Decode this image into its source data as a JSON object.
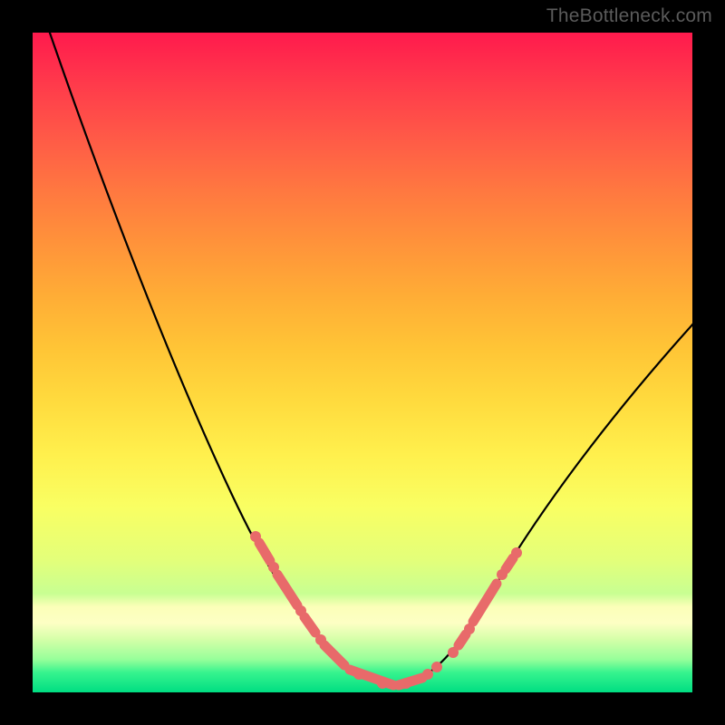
{
  "watermark": "TheBottleneck.com",
  "colors": {
    "background": "#000000",
    "curve": "#000000",
    "marker": "#e86a6a",
    "gradient_top": "#ff1a4d",
    "gradient_bottom": "#00de82"
  },
  "chart_data": {
    "type": "line",
    "title": "",
    "xlabel": "",
    "ylabel": "",
    "xlim": [
      0,
      1
    ],
    "ylim": [
      0,
      1
    ],
    "series": [
      {
        "name": "curve",
        "x": [
          0.02,
          0.06,
          0.1,
          0.14,
          0.18,
          0.22,
          0.26,
          0.3,
          0.34,
          0.38,
          0.42,
          0.46,
          0.5,
          0.54,
          0.58,
          0.62,
          0.66,
          0.7,
          0.74,
          0.78,
          0.82,
          0.86,
          0.9,
          0.94,
          0.98,
          1.0
        ],
        "y": [
          1.03,
          0.94,
          0.82,
          0.7,
          0.59,
          0.49,
          0.4,
          0.32,
          0.25,
          0.18,
          0.12,
          0.07,
          0.03,
          0.01,
          0.02,
          0.06,
          0.11,
          0.17,
          0.23,
          0.29,
          0.35,
          0.41,
          0.46,
          0.51,
          0.55,
          0.57
        ]
      }
    ],
    "markers": {
      "name": "highlighted-points",
      "x": [
        0.34,
        0.36,
        0.38,
        0.4,
        0.42,
        0.44,
        0.46,
        0.48,
        0.5,
        0.52,
        0.54,
        0.56,
        0.58,
        0.6,
        0.62,
        0.66,
        0.68,
        0.7
      ],
      "y": [
        0.25,
        0.21,
        0.18,
        0.15,
        0.12,
        0.09,
        0.07,
        0.05,
        0.03,
        0.02,
        0.01,
        0.02,
        0.02,
        0.04,
        0.06,
        0.11,
        0.14,
        0.17
      ]
    }
  }
}
